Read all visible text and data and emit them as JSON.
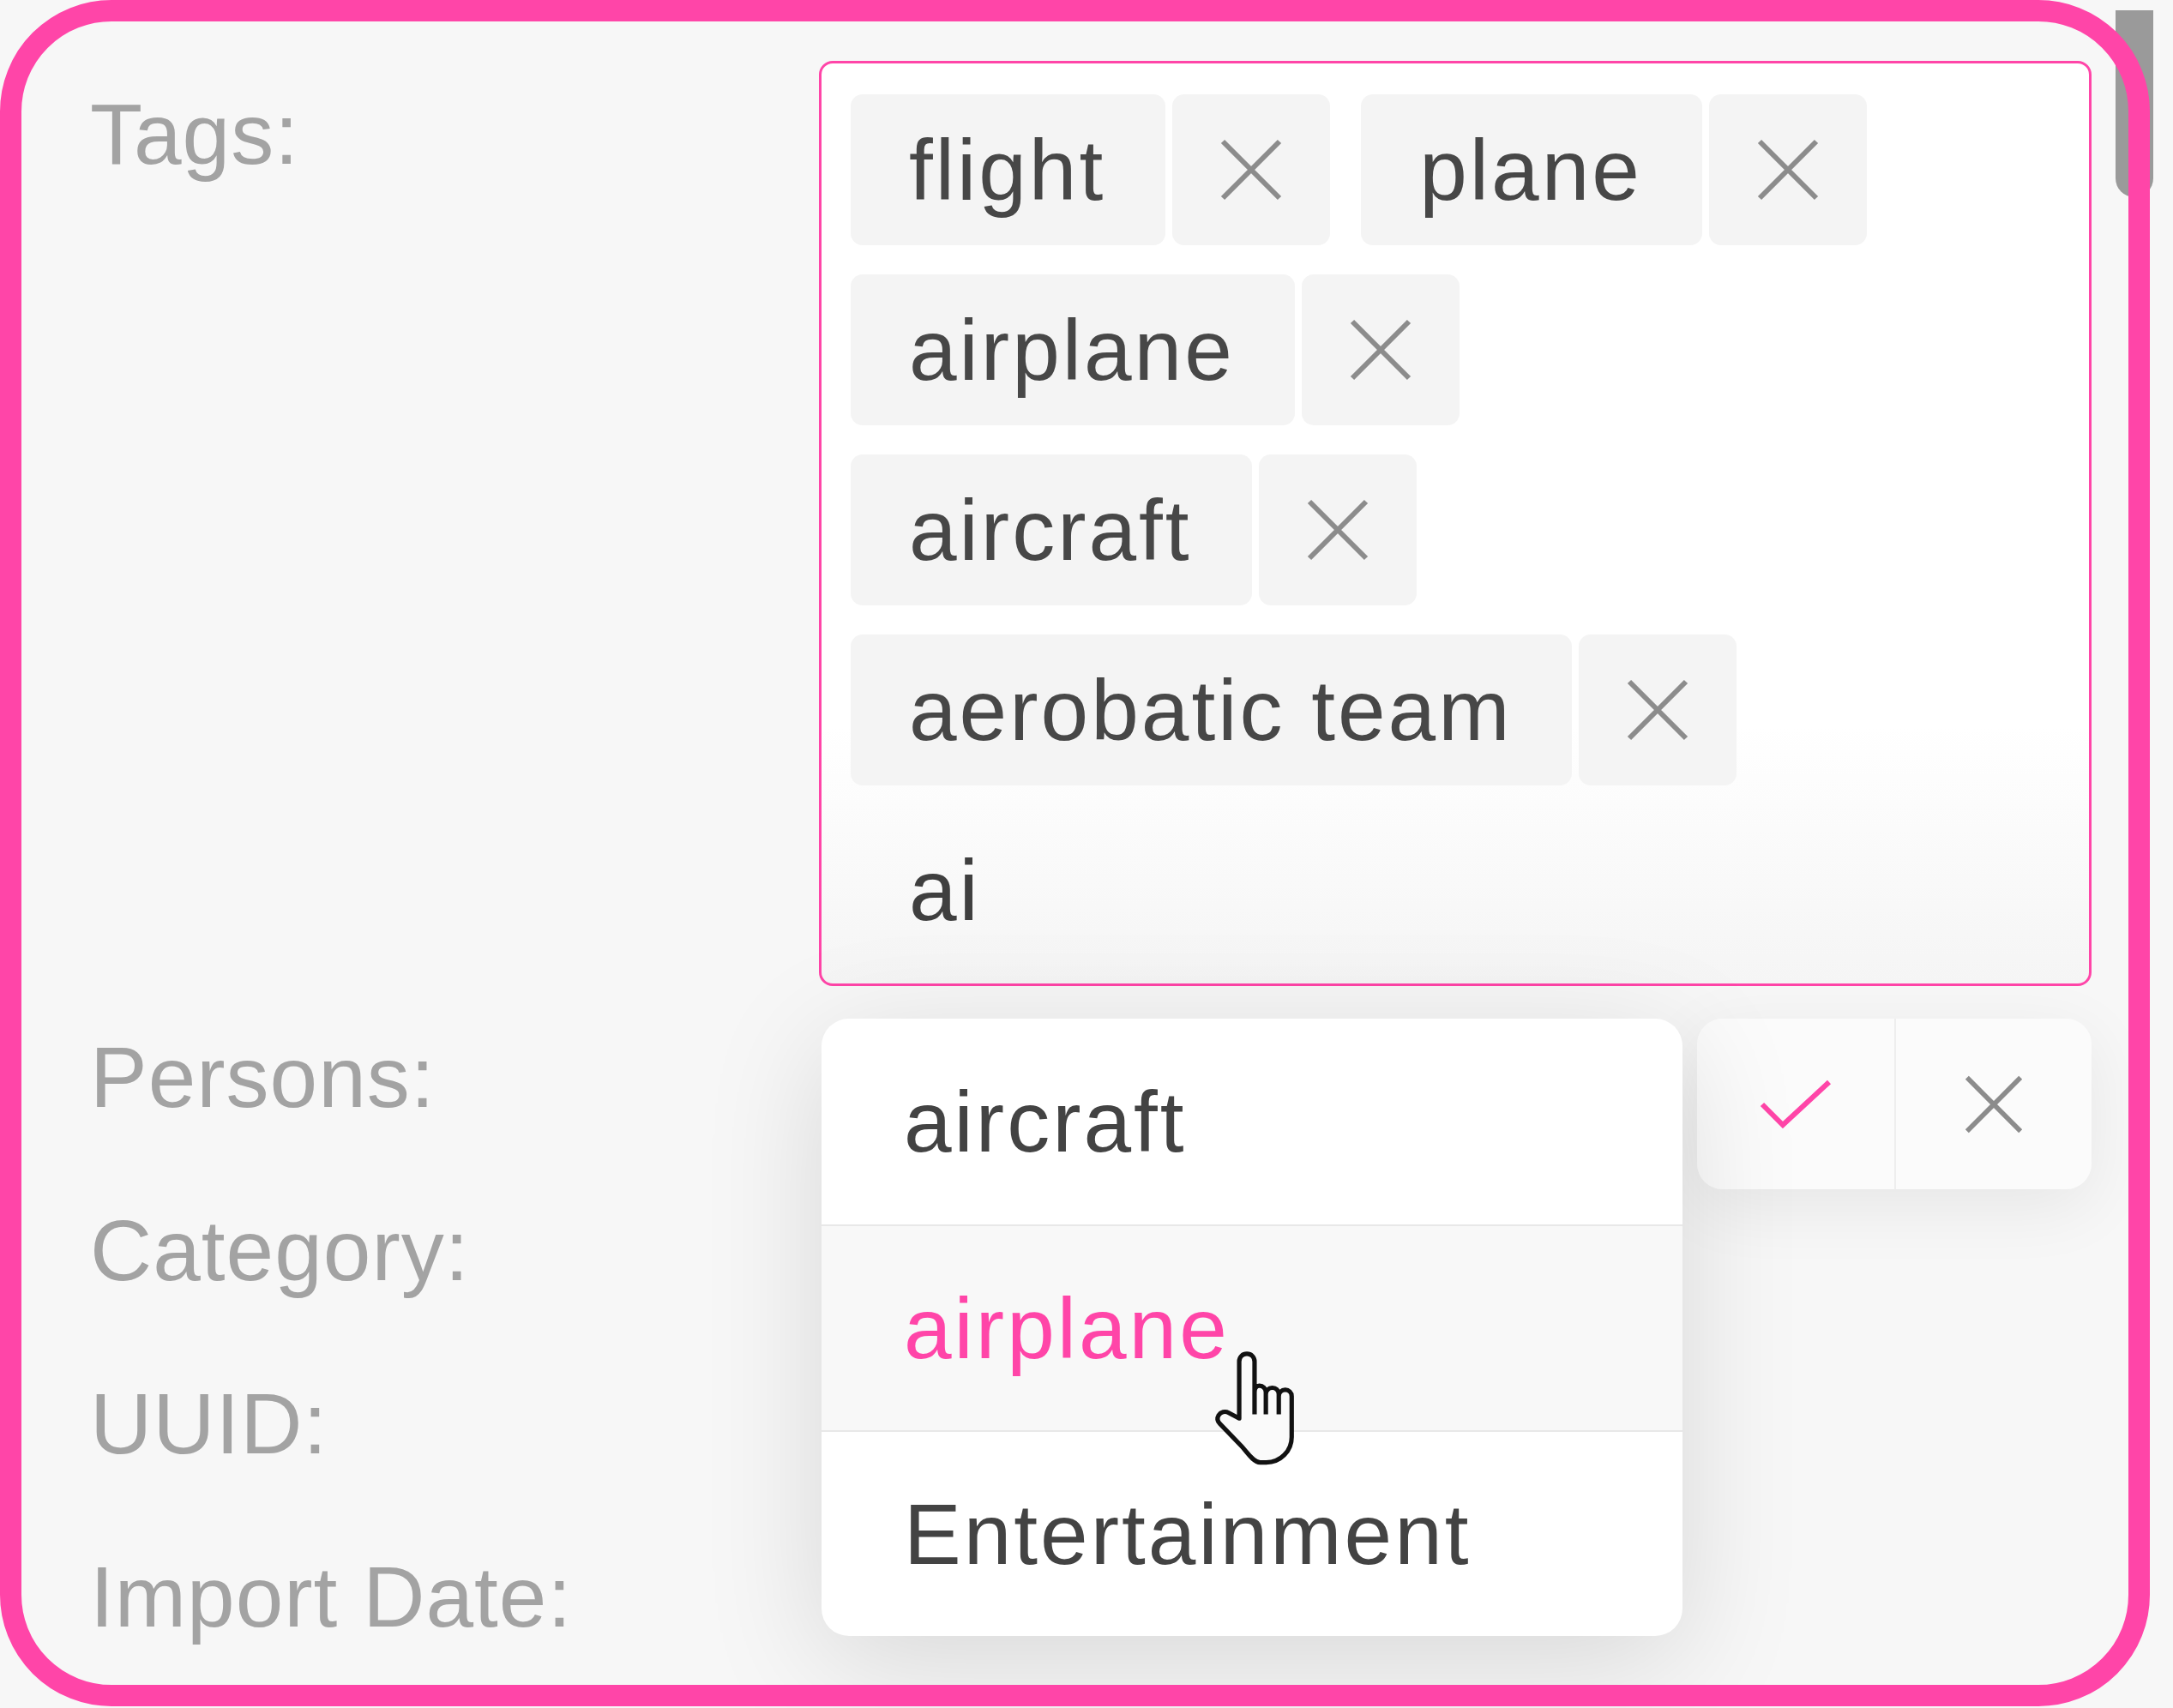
{
  "form": {
    "fields": [
      {
        "label": "Tags:"
      },
      {
        "label": "Persons:"
      },
      {
        "label": "Category:"
      },
      {
        "label": "UUID:"
      },
      {
        "label": "Import Date:"
      }
    ]
  },
  "tag_editor": {
    "focused": true,
    "tags": [
      {
        "label": "flight"
      },
      {
        "label": "plane"
      },
      {
        "label": "airplane"
      },
      {
        "label": "aircraft"
      },
      {
        "label": "aerobatic team"
      }
    ],
    "input": {
      "value": "ai"
    },
    "suggestions": [
      {
        "label": "aircraft",
        "highlighted": false
      },
      {
        "label": "airplane",
        "highlighted": true
      },
      {
        "label": "Entertainment",
        "highlighted": false
      }
    ]
  }
}
